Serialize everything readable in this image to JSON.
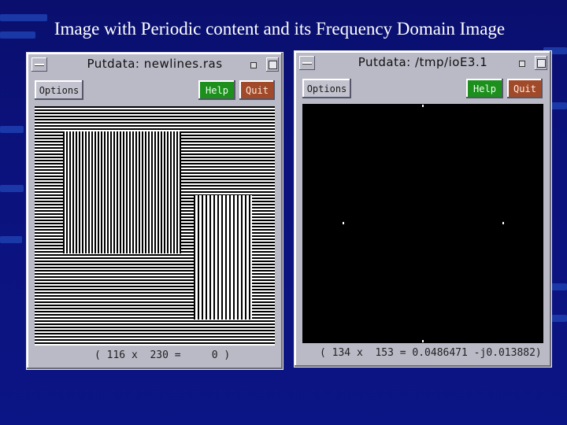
{
  "slide": {
    "title": "Image with Periodic content and its Frequency Domain Image"
  },
  "windows": [
    {
      "title": "Putdata: newlines.ras",
      "options_label": "Options",
      "help_label": "Help",
      "quit_label": "Quit",
      "status": "( 116 x  230 =     0 )"
    },
    {
      "title": "Putdata: /tmp/ioE3.1",
      "options_label": "Options",
      "help_label": "Help",
      "quit_label": "Quit",
      "status": "( 134 x  153 = 0.0486471 -j0.013882)"
    }
  ],
  "colors": {
    "background": "#0b127d",
    "window": "#b9bac6",
    "help_button": "#1c8f1c",
    "quit_button": "#a14a2a"
  }
}
